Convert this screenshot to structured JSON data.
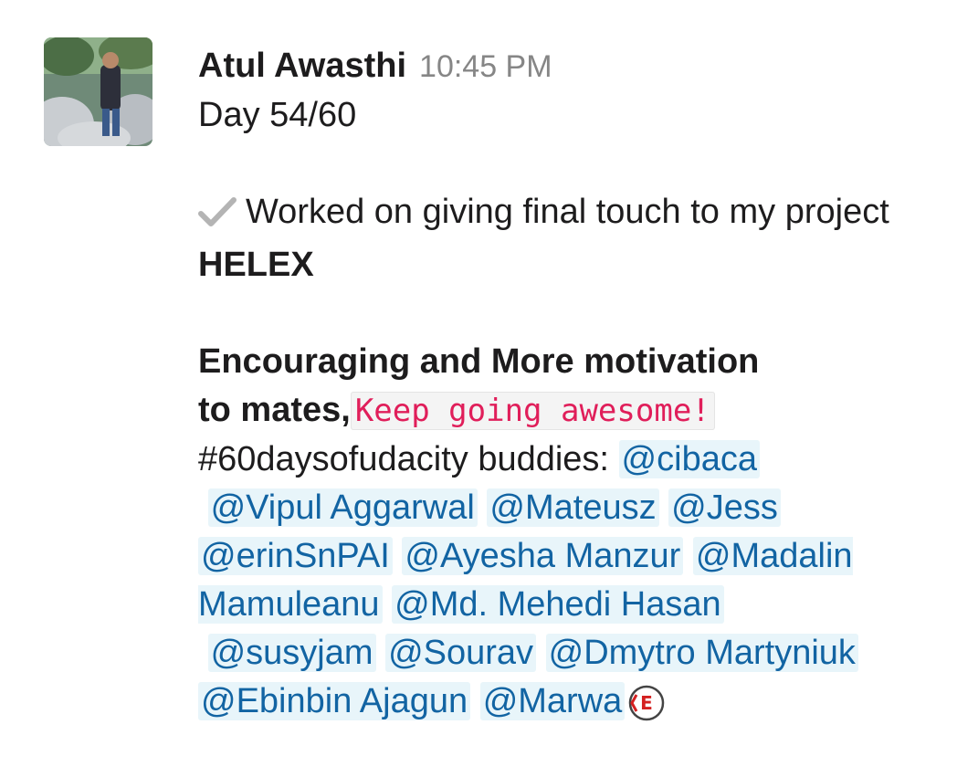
{
  "message": {
    "author": "Atul Awasthi",
    "time": "10:45 PM",
    "line_day": "Day 54/60",
    "check_text": "Worked on giving final touch to my project ",
    "project_name": "HELEX",
    "bold_line1": "Encouraging and More motivation",
    "bold_line2": "to mates,",
    "code_text": "Keep going awesome!",
    "hashtag_text": "#60daysofudacity buddies: ",
    "mentions": [
      "@cibaca",
      "@Vipul Aggarwal",
      "@Mateusz",
      "@Jess",
      "@erinSnPAI",
      "@Ayesha Manzur",
      "@Madalin Mamuleanu",
      "@Md. Mehedi Hasan",
      "@susyjam",
      "@Sourav",
      "@Dmytro Martyniuk",
      "@Ebinbin Ajagun",
      "@Marwa"
    ],
    "emoji_letter": "E"
  },
  "icons": {
    "check": "heavy-check-mark-icon",
    "emoji": "custom-e-emoji-icon"
  }
}
